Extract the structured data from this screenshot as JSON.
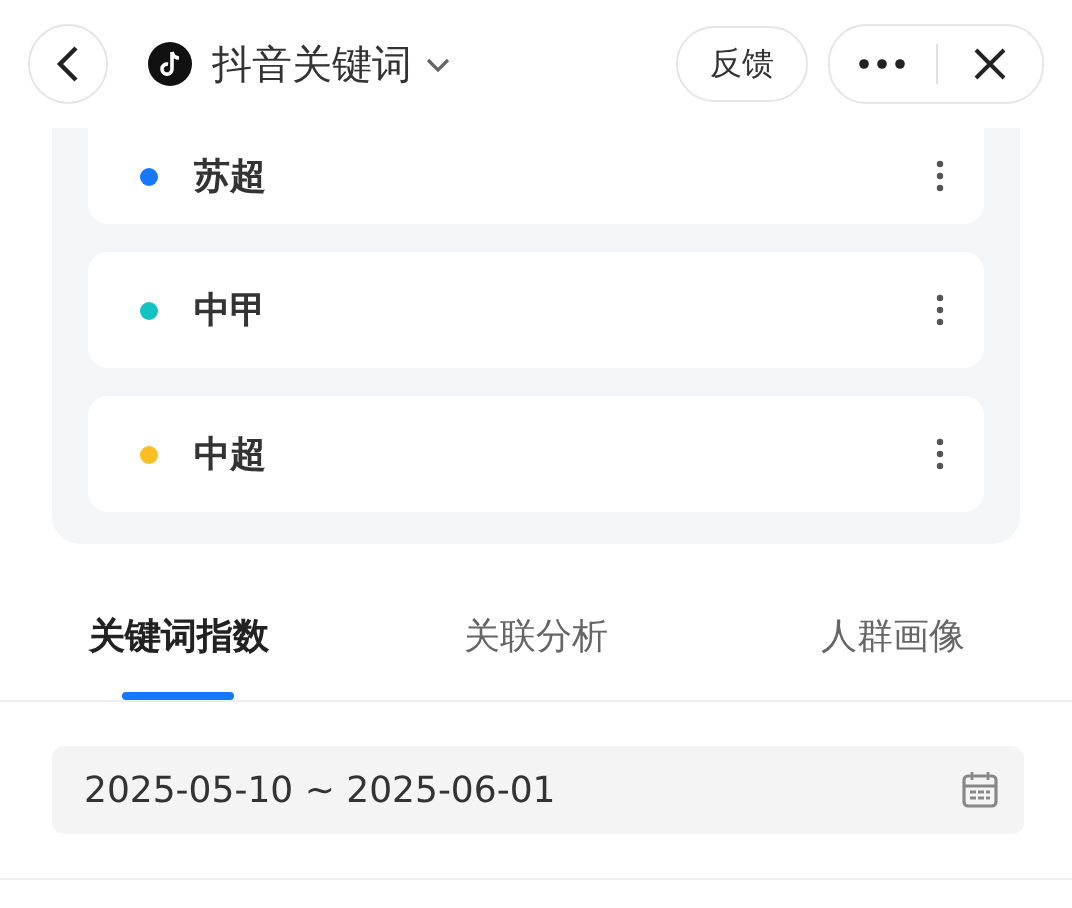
{
  "header": {
    "title": "抖音关键词",
    "feedback": "反馈"
  },
  "keywords": [
    {
      "name": "苏超",
      "color": "#1677ff"
    },
    {
      "name": "中甲",
      "color": "#13c2c2"
    },
    {
      "name": "中超",
      "color": "#fbbf24"
    }
  ],
  "tabs": [
    {
      "label": "关键词指数",
      "selected": true
    },
    {
      "label": "关联分析",
      "selected": false
    },
    {
      "label": "人群画像",
      "selected": false
    }
  ],
  "date_range": {
    "value": "2025-05-10 ~ 2025-06-01"
  }
}
